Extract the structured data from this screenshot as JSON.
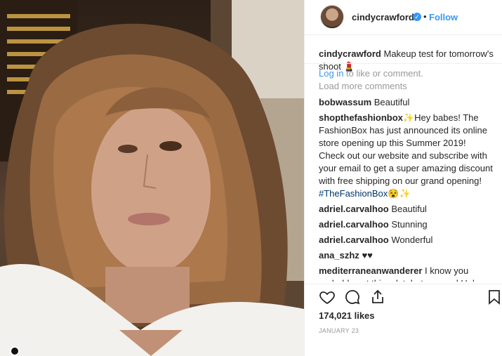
{
  "header": {
    "username": "cindycrawford",
    "separator": "•",
    "follow_label": "Follow"
  },
  "caption": {
    "username": "cindycrawford",
    "text": "Makeup test for tomorrow's shoot 💄"
  },
  "load_more_label": "Load more comments",
  "comments": [
    {
      "username": "bobwassum",
      "text": "Beautiful"
    },
    {
      "username": "shopthefashionbox",
      "text": "✨Hey babes! The FashionBox has just announced its online store opening up this Summer 2019! Check out our website and subscribe with your email to get a super amazing discount with free shipping on our grand opening!",
      "hashtag": "#TheFashionBox",
      "suffix": "😵✨"
    },
    {
      "username": "adriel.carvalhoo",
      "text": "Beautiful"
    },
    {
      "username": "adriel.carvalhoo",
      "text": "Stunning"
    },
    {
      "username": "adriel.carvalhoo",
      "text": "Wonderful"
    },
    {
      "username": "ana_szhz",
      "text": "♥♥"
    },
    {
      "username": "mediterraneanwanderer",
      "text": "I know you probably get this a lot, but you and Helena were two of my all time favourite"
    }
  ],
  "likes": "174,021 likes",
  "date": "JANUARY 23",
  "login": {
    "link": "Log in",
    "rest": " to like or comment."
  },
  "icons": [
    "heart-icon",
    "comment-icon",
    "share-icon",
    "bookmark-icon",
    "verified-badge-icon"
  ],
  "colors": {
    "accent": "#3897f0",
    "muted": "#999999",
    "hashtag": "#003569"
  }
}
